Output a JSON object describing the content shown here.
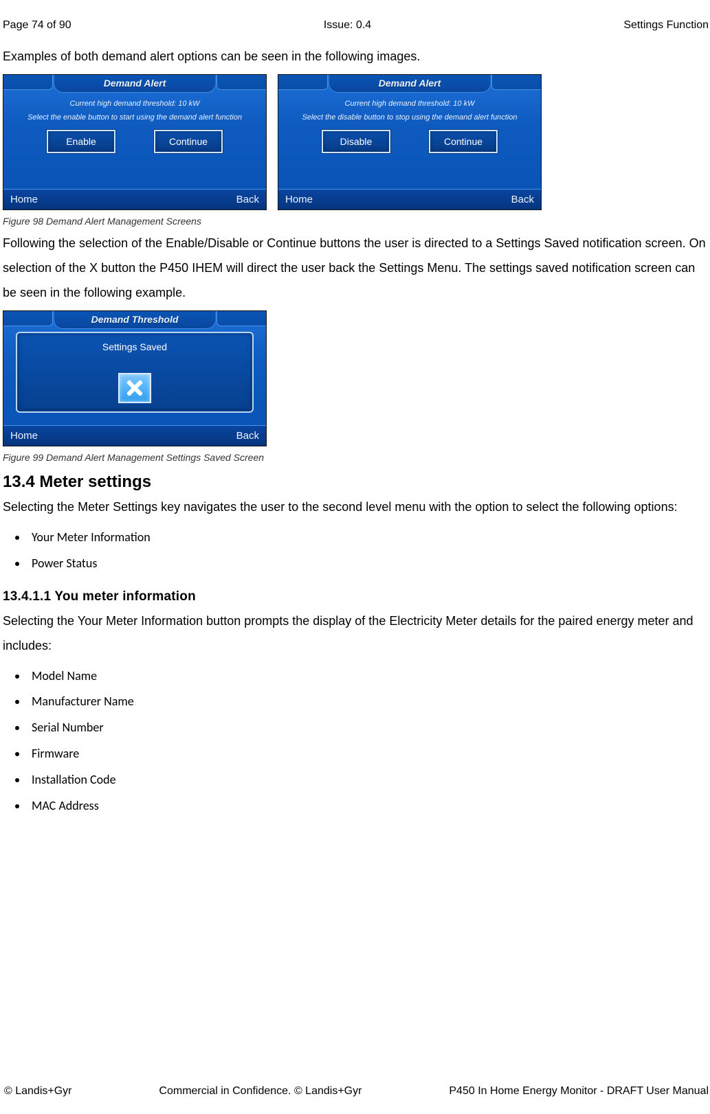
{
  "header": {
    "page": "Page 74 of 90",
    "issue": "Issue: 0.4",
    "section": "Settings Function"
  },
  "intro": "Examples of both demand alert options can be seen in the following images.",
  "screens": [
    {
      "title": "Demand Alert",
      "line1": "Current high demand threshold:   10 kW",
      "line2": "Select the enable button to start using the demand alert function",
      "btn1": "Enable",
      "btn2": "Continue",
      "home": "Home",
      "back": "Back"
    },
    {
      "title": "Demand Alert",
      "line1": "Current high demand threshold:   10 kW",
      "line2": "Select the disable button to stop using the demand alert function",
      "btn1": "Disable",
      "btn2": "Continue",
      "home": "Home",
      "back": "Back"
    }
  ],
  "caption1": "Figure 98 Demand Alert Management Screens",
  "para1": "Following the selection of the Enable/Disable or Continue buttons the user is directed to a Settings Saved notification screen. On selection of the X button the P450 IHEM will direct the user back the Settings Menu. The settings saved notification screen can be seen in the following example.",
  "savedScreen": {
    "title": "Demand Threshold",
    "modal": "Settings Saved",
    "home": "Home",
    "back": "Back"
  },
  "caption2": "Figure 99 Demand Alert Management Settings Saved Screen",
  "sec134": {
    "heading": "13.4    Meter settings",
    "para": "Selecting the Meter Settings key navigates the user to the second level menu with the option to select the following options:",
    "bullets": [
      "Your Meter Information",
      "Power Status"
    ]
  },
  "sec13411": {
    "heading": "13.4.1.1    You meter information",
    "para": "Selecting the Your Meter Information button prompts the display of the Electricity Meter details for the paired energy meter and includes:",
    "bullets": [
      "Model Name",
      "Manufacturer Name",
      "Serial Number",
      "Firmware",
      "Installation Code",
      "MAC Address"
    ]
  },
  "footer": {
    "left": "© Landis+Gyr",
    "center": "Commercial in Confidence. © Landis+Gyr",
    "right": "P450 In Home Energy Monitor - DRAFT User Manual"
  }
}
